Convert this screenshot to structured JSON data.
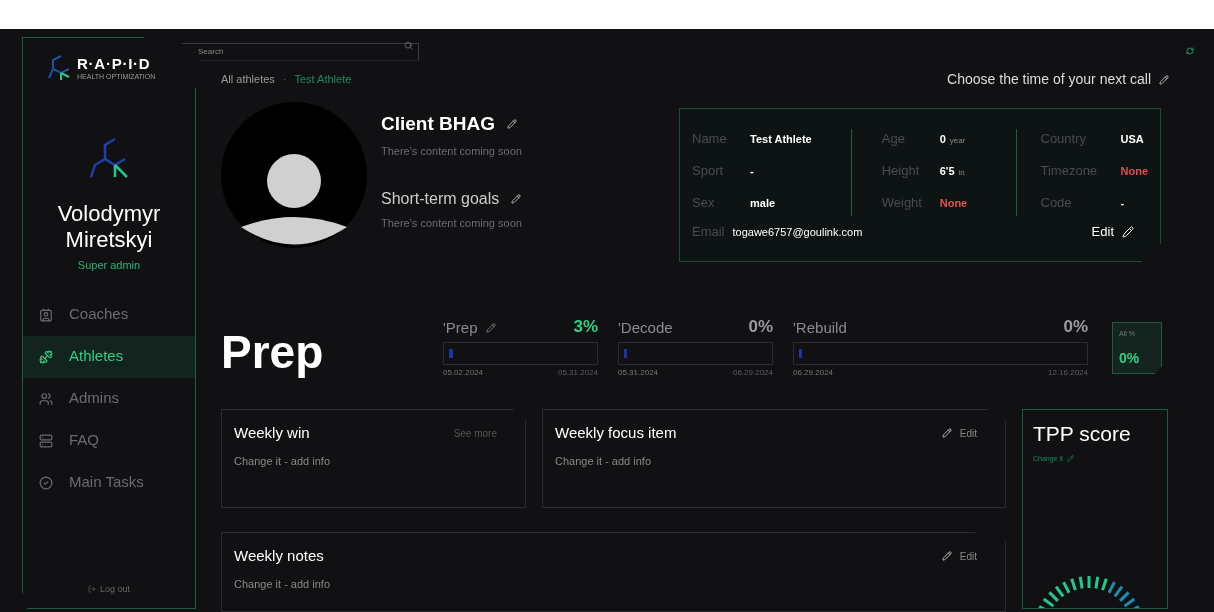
{
  "search": {
    "placeholder": "Search"
  },
  "logo": {
    "name": "R·A·P·I·D",
    "tagline": "HEALTH OPTIMIZATION"
  },
  "user": {
    "name": "Volodymyr Miretskyi",
    "role": "Super admin"
  },
  "nav": [
    {
      "label": "Coaches",
      "selected": false
    },
    {
      "label": "Athletes",
      "selected": true
    },
    {
      "label": "Admins",
      "selected": false
    },
    {
      "label": "FAQ",
      "selected": false
    },
    {
      "label": "Main Tasks",
      "selected": false
    }
  ],
  "logout": "Log out",
  "breadcrumb": [
    {
      "label": "All athletes",
      "selected": false
    },
    {
      "label": "Test Athlete",
      "selected": true
    }
  ],
  "breadcrumb_separator": "·",
  "next_call": "Choose the time of your next call",
  "goals": [
    {
      "title": "Client BHAG",
      "text": "There's content coming soon",
      "kind": "bold"
    },
    {
      "title": "Short-term goals",
      "text": "There's content coming soon",
      "kind": "light"
    }
  ],
  "profile": {
    "columns": [
      [
        {
          "label": "Name",
          "value": "Test Athlete",
          "missing": false
        },
        {
          "label": "Sport",
          "value": "-",
          "missing": false
        },
        {
          "label": "Sex",
          "value": "male",
          "missing": false
        }
      ],
      [
        {
          "label": "Age",
          "value": "0",
          "unit": "year",
          "missing": false
        },
        {
          "label": "Height",
          "value": "6'5",
          "unit": "in",
          "missing": false
        },
        {
          "label": "Weight",
          "value": "None",
          "missing": true
        }
      ],
      [
        {
          "label": "Country",
          "value": "USA",
          "missing": false
        },
        {
          "label": "Timezone",
          "value": "None",
          "missing": true
        },
        {
          "label": "Code",
          "value": "-",
          "missing": false
        }
      ]
    ],
    "email_label": "Email",
    "email": "togawe6757@goulink.com",
    "edit": "Edit"
  },
  "phase_title": "Prep",
  "phases": [
    {
      "name": "'Prep",
      "percent": "3%",
      "level": 0.03,
      "start": "05.02.2024",
      "end": "05.31.2024",
      "editable": true,
      "active": true
    },
    {
      "name": "'Decode",
      "percent": "0%",
      "level": 0,
      "start": "05.31.2024",
      "end": "06.29.2024",
      "editable": false,
      "active": false
    },
    {
      "name": "'Rebuild",
      "percent": "0%",
      "level": 0,
      "start": "06.29.2024",
      "end": "12.16.2024",
      "editable": false,
      "active": false
    }
  ],
  "all": {
    "label": "All %",
    "percent": "0%"
  },
  "cards": [
    {
      "title": "Weekly win",
      "text": "Change it - add info",
      "action": "See more",
      "kind": "more"
    },
    {
      "title": "Weekly focus item",
      "text": "Change it - add info",
      "action": "Edit",
      "kind": "edit"
    }
  ],
  "notes": {
    "title": "Weekly notes",
    "text": "Change it - add info",
    "action": "Edit",
    "kind": "edit"
  },
  "tpp": {
    "title": "TPP score",
    "action": "Change it"
  }
}
